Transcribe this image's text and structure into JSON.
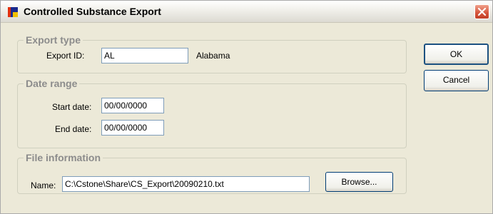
{
  "window": {
    "title": "Controlled Substance Export"
  },
  "export_type": {
    "legend": "Export type",
    "export_id_label": "Export ID:",
    "export_id_value": "AL",
    "state_name": "Alabama"
  },
  "date_range": {
    "legend": "Date range",
    "start_label": "Start date:",
    "start_value": "00/00/0000",
    "end_label": "End date:",
    "end_value": "00/00/0000"
  },
  "file_info": {
    "legend": "File information",
    "name_label": "Name:",
    "name_value": "C:\\Cstone\\Share\\CS_Export\\20090210.txt",
    "browse_label": "Browse..."
  },
  "buttons": {
    "ok_label": "OK",
    "cancel_label": "Cancel"
  },
  "icons": {
    "app": "window-icon",
    "close": "close-icon"
  },
  "colors": {
    "close_red": "#d4533a",
    "legend_gray": "#8c8c8c",
    "input_border": "#7f9db9"
  }
}
